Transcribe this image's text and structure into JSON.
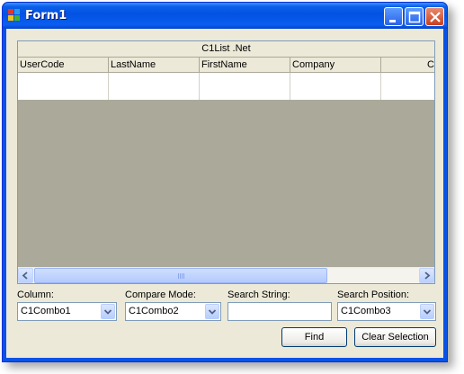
{
  "window": {
    "title": "Form1",
    "icons": {
      "app": "form-app-icon",
      "minimize": "minimize-icon",
      "maximize": "maximize-icon",
      "close": "close-icon"
    }
  },
  "grid": {
    "caption": "C1List .Net",
    "columns": [
      "UserCode",
      "LastName",
      "FirstName",
      "Company",
      "C"
    ],
    "scroll_grip": "|||"
  },
  "controls": {
    "column": {
      "label": "Column:",
      "value": "C1Combo1"
    },
    "compare_mode": {
      "label": "Compare Mode:",
      "value": "C1Combo2"
    },
    "search_string": {
      "label": "Search String:",
      "value": ""
    },
    "search_position": {
      "label": "Search Position:",
      "value": "C1Combo3"
    }
  },
  "buttons": {
    "find": "Find",
    "clear_selection": "Clear Selection"
  },
  "colors": {
    "titlebar": "#0a5fe8",
    "client": "#ece9d8",
    "grid_empty": "#aba99a"
  }
}
